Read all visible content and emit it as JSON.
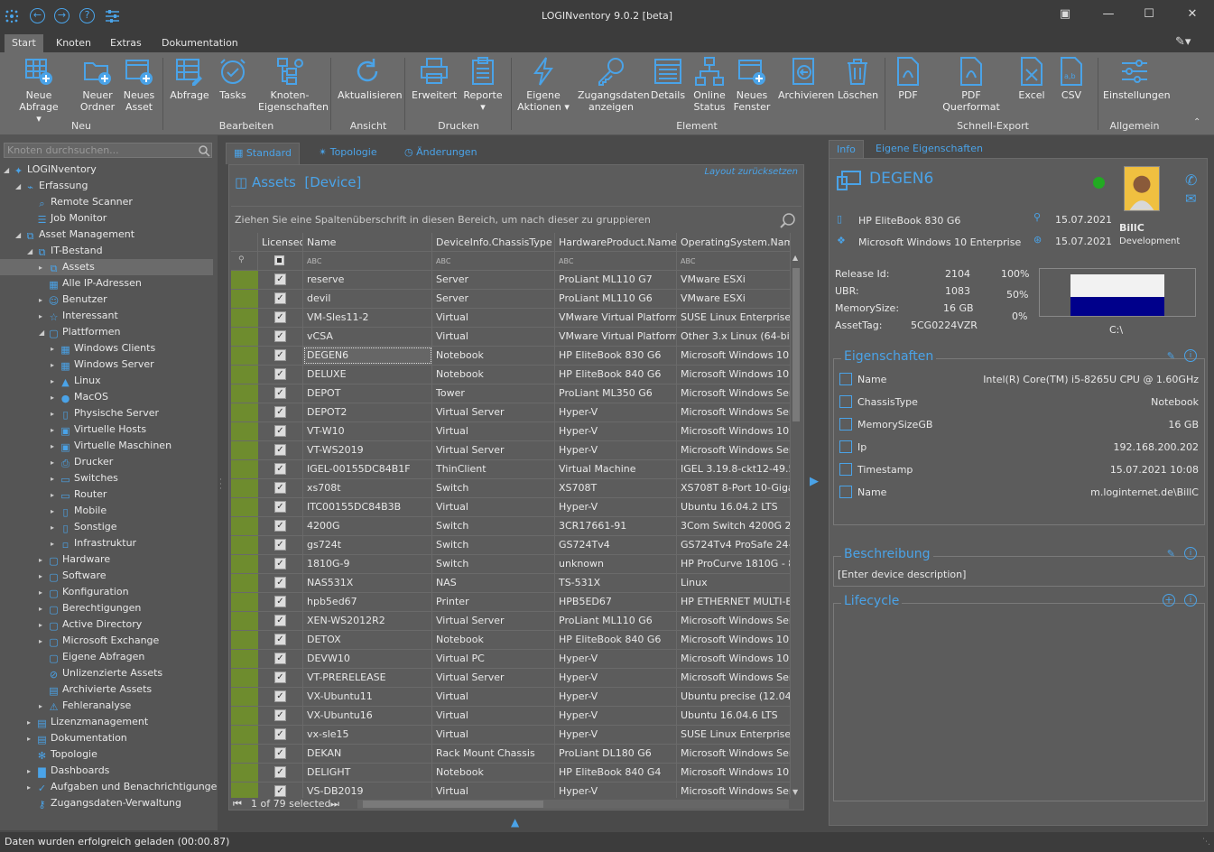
{
  "app": {
    "title": "LOGINventory 9.0.2 [beta]"
  },
  "menu_tabs": [
    "Start",
    "Knoten",
    "Extras",
    "Dokumentation"
  ],
  "ribbon": {
    "buttons": [
      {
        "label": "Neue Abfrage",
        "icon": "grid-add-icon"
      },
      {
        "label": "Neuer Ordner",
        "icon": "folder-add-icon"
      },
      {
        "label": "Neues Asset",
        "icon": "window-add-icon"
      },
      {
        "label": "Abfrage",
        "icon": "grid-edit-icon"
      },
      {
        "label": "Tasks",
        "icon": "clock-check-icon"
      },
      {
        "label": "Knoten-Eigenschaften",
        "icon": "node-properties-icon"
      },
      {
        "label": "Aktualisieren",
        "icon": "refresh-icon"
      },
      {
        "label": "Erweitert",
        "icon": "printer-icon"
      },
      {
        "label": "Reporte",
        "icon": "clipboard-icon"
      },
      {
        "label": "Eigene Aktionen",
        "icon": "lightning-icon"
      },
      {
        "label": "Zugangsdaten anzeigen",
        "icon": "key-icon"
      },
      {
        "label": "Details",
        "icon": "details-icon"
      },
      {
        "label": "Online Status",
        "icon": "network-status-icon"
      },
      {
        "label": "Neues Fenster",
        "icon": "new-window-icon"
      },
      {
        "label": "Archivieren",
        "icon": "archive-icon"
      },
      {
        "label": "Löschen",
        "icon": "trash-icon"
      },
      {
        "label": "PDF",
        "icon": "pdf-icon"
      },
      {
        "label": "PDF Querformat",
        "icon": "pdf-landscape-icon"
      },
      {
        "label": "Excel",
        "icon": "excel-icon"
      },
      {
        "label": "CSV",
        "icon": "csv-icon"
      },
      {
        "label": "Einstellungen",
        "icon": "settings-sliders-icon"
      }
    ],
    "groups": [
      "Neu",
      "Bearbeiten",
      "Ansicht",
      "Drucken",
      "Element",
      "Schnell-Export",
      "Allgemein"
    ]
  },
  "tree": {
    "search_placeholder": "Knoten durchsuchen...",
    "items": [
      {
        "label": "LOGINventory",
        "icon": "logo-icon"
      },
      {
        "label": "Erfassung",
        "icon": "rss-icon"
      },
      {
        "label": "Remote Scanner",
        "icon": "scanner-icon"
      },
      {
        "label": "Job Monitor",
        "icon": "job-icon"
      },
      {
        "label": "Asset Management",
        "icon": "asset-mgmt-icon"
      },
      {
        "label": "IT-Bestand",
        "icon": "it-stock-icon"
      },
      {
        "label": "Assets",
        "icon": "assets-icon"
      },
      {
        "label": "Alle IP-Adressen",
        "icon": "grid-icon"
      },
      {
        "label": "Benutzer",
        "icon": "users-icon"
      },
      {
        "label": "Interessant",
        "icon": "star-icon"
      },
      {
        "label": "Plattformen",
        "icon": "folder-icon"
      },
      {
        "label": "Windows Clients",
        "icon": "windows-icon"
      },
      {
        "label": "Windows Server",
        "icon": "windows-icon"
      },
      {
        "label": "Linux",
        "icon": "linux-icon"
      },
      {
        "label": "MacOS",
        "icon": "apple-icon"
      },
      {
        "label": "Physische Server",
        "icon": "server-icon"
      },
      {
        "label": "Virtuelle Hosts",
        "icon": "host-icon"
      },
      {
        "label": "Virtuelle Maschinen",
        "icon": "vm-icon"
      },
      {
        "label": "Drucker",
        "icon": "printer-icon"
      },
      {
        "label": "Switches",
        "icon": "switch-icon"
      },
      {
        "label": "Router",
        "icon": "router-icon"
      },
      {
        "label": "Mobile",
        "icon": "mobile-icon"
      },
      {
        "label": "Sonstige",
        "icon": "other-icon"
      },
      {
        "label": "Infrastruktur",
        "icon": "infrastructure-icon"
      },
      {
        "label": "Hardware",
        "icon": "folder-icon"
      },
      {
        "label": "Software",
        "icon": "folder-icon"
      },
      {
        "label": "Konfiguration",
        "icon": "folder-icon"
      },
      {
        "label": "Berechtigungen",
        "icon": "folder-icon"
      },
      {
        "label": "Active Directory",
        "icon": "folder-icon"
      },
      {
        "label": "Microsoft Exchange",
        "icon": "folder-icon"
      },
      {
        "label": "Eigene Abfragen",
        "icon": "folder-icon"
      },
      {
        "label": "Unlizenzierte Assets",
        "icon": "unlicensed-icon"
      },
      {
        "label": "Archivierte Assets",
        "icon": "archive-icon"
      },
      {
        "label": "Fehleranalyse",
        "icon": "warning-icon"
      },
      {
        "label": "Lizenzmanagement",
        "icon": "license-icon"
      },
      {
        "label": "Dokumentation",
        "icon": "document-icon"
      },
      {
        "label": "Topologie",
        "icon": "topology-icon"
      },
      {
        "label": "Dashboards",
        "icon": "chart-icon"
      },
      {
        "label": "Aufgaben und Benachrichtigungen",
        "icon": "check-circle-icon"
      },
      {
        "label": "Zugangsdaten-Verwaltung",
        "icon": "key-icon"
      }
    ]
  },
  "center": {
    "tabs": [
      "Standard",
      "Topologie",
      "Änderungen"
    ],
    "layout_reset": "Layout zurücksetzen",
    "header_title": "Assets",
    "header_sub": "[Device]",
    "group_hint": "Ziehen Sie eine Spaltenüberschrift in diesen Bereich, um nach dieser zu gruppieren",
    "columns": [
      "Licensed",
      "Name",
      "DeviceInfo.ChassisType",
      "HardwareProduct.Name",
      "OperatingSystem.Name"
    ],
    "filter_token": "ABC",
    "rows": [
      [
        "reserve",
        "Server",
        "ProLiant ML110 G7",
        "VMware ESXi"
      ],
      [
        "devil",
        "Server",
        "ProLiant ML110 G6",
        "VMware ESXi"
      ],
      [
        "VM-Sles11-2",
        "Virtual",
        "VMware Virtual Platform",
        "SUSE Linux Enterprise 11"
      ],
      [
        "vCSA",
        "Virtual",
        "VMware Virtual Platform",
        "Other 3.x Linux (64-bit)"
      ],
      [
        "DEGEN6",
        "Notebook",
        "HP EliteBook 830 G6",
        "Microsoft Windows 10 Ent"
      ],
      [
        "DELUXE",
        "Notebook",
        "HP EliteBook 840 G6",
        "Microsoft Windows 10 Ent"
      ],
      [
        "DEPOT",
        "Tower",
        "ProLiant ML350 G6",
        "Microsoft Windows Server"
      ],
      [
        "DEPOT2",
        "Virtual Server",
        "Hyper-V",
        "Microsoft Windows Server"
      ],
      [
        "VT-W10",
        "Virtual",
        "Hyper-V",
        "Microsoft Windows 10 Ent"
      ],
      [
        "VT-WS2019",
        "Virtual Server",
        "Hyper-V",
        "Microsoft Windows Server"
      ],
      [
        "IGEL-00155DC84B1F",
        "ThinClient",
        "Virtual Machine",
        "IGEL 3.19.8-ckt12-49.55-"
      ],
      [
        "xs708t",
        "Switch",
        "XS708T",
        "XS708T 8-Port 10-Gigabit"
      ],
      [
        "ITC00155DC84B3B",
        "Virtual",
        "Hyper-V",
        "Ubuntu 16.04.2 LTS"
      ],
      [
        "4200G",
        "Switch",
        "3CR17661-91",
        "3Com Switch 4200G 24-Po"
      ],
      [
        "gs724t",
        "Switch",
        "GS724Tv4",
        "GS724Tv4 ProSafe 24-po"
      ],
      [
        "1810G-9",
        "Switch",
        "unknown",
        "HP ProCurve 1810G - 8 G"
      ],
      [
        "NAS531X",
        "NAS",
        "TS-531X",
        "Linux"
      ],
      [
        "hpb5ed67",
        "Printer",
        "HPB5ED67",
        "HP ETHERNET MULTI-ENV"
      ],
      [
        "XEN-WS2012R2",
        "Virtual Server",
        "ProLiant ML110 G6",
        "Microsoft Windows Server"
      ],
      [
        "DETOX",
        "Notebook",
        "HP EliteBook 840 G6",
        "Microsoft Windows 10 Pro"
      ],
      [
        "DEVW10",
        "Virtual PC",
        "Hyper-V",
        "Microsoft Windows 10 Ent"
      ],
      [
        "VT-PRERELEASE",
        "Virtual Server",
        "Hyper-V",
        "Microsoft Windows Server"
      ],
      [
        "VX-Ubuntu11",
        "Virtual",
        "Hyper-V",
        "Ubuntu precise (12.04.5 l"
      ],
      [
        "VX-Ubuntu16",
        "Virtual",
        "Hyper-V",
        "Ubuntu 16.04.6 LTS"
      ],
      [
        "vx-sle15",
        "Virtual",
        "Hyper-V",
        "SUSE Linux Enterprise Ser"
      ],
      [
        "DEKAN",
        "Rack Mount Chassis",
        "ProLiant DL180 G6",
        "Microsoft Windows Server"
      ],
      [
        "DELIGHT",
        "Notebook",
        "HP EliteBook 840 G4",
        "Microsoft Windows 10 Ent"
      ],
      [
        "VS-DB2019",
        "Virtual",
        "Hyper-V",
        "Microsoft Windows Server"
      ]
    ],
    "footer": "1 of 79 selected"
  },
  "right": {
    "tabs": [
      "Info",
      "Eigene Eigenschaften"
    ],
    "device_name": "DEGEN6",
    "hardware": "HP EliteBook 830 G6",
    "os": "Microsoft Windows 10 Enterprise",
    "date1": "15.07.2021",
    "date2": "15.07.2021",
    "user_name": "BillC",
    "user_dept": "Development",
    "release_label": "Release Id:",
    "release_value": "2104",
    "ubr_label": "UBR:",
    "ubr_value": "1083",
    "mem_label": "MemorySize:",
    "mem_value": "16 GB",
    "tag_label": "AssetTag:",
    "tag_value": "5CG0224VZR",
    "disk": {
      "label": "C:\\",
      "ticks": [
        "100%",
        "50%",
        "0%"
      ],
      "used_fraction": 0.45,
      "used_color": "#00008b",
      "free_color": "#f2f2f2"
    },
    "eigenschaften_title": "Eigenschaften",
    "properties": [
      {
        "label": "Name",
        "value": "Intel(R) Core(TM) i5-8265U CPU @ 1.60GHz"
      },
      {
        "label": "ChassisType",
        "value": "Notebook"
      },
      {
        "label": "MemorySizeGB",
        "value": "16 GB"
      },
      {
        "label": "Ip",
        "value": "192.168.200.202"
      },
      {
        "label": "Timestamp",
        "value": "15.07.2021 10:08"
      },
      {
        "label": "Name",
        "value": "m.loginternet.de\\BillC"
      }
    ],
    "beschreibung_title": "Beschreibung",
    "beschreibung_text": "[Enter device description]",
    "lifecycle_title": "Lifecycle"
  },
  "status": {
    "text": "Daten wurden erfolgreich geladen (00:00.87)"
  },
  "colors": {
    "accent": "#4aa3e8",
    "licensed_indicator": "#6e8c2e",
    "online": "#22aa22"
  }
}
